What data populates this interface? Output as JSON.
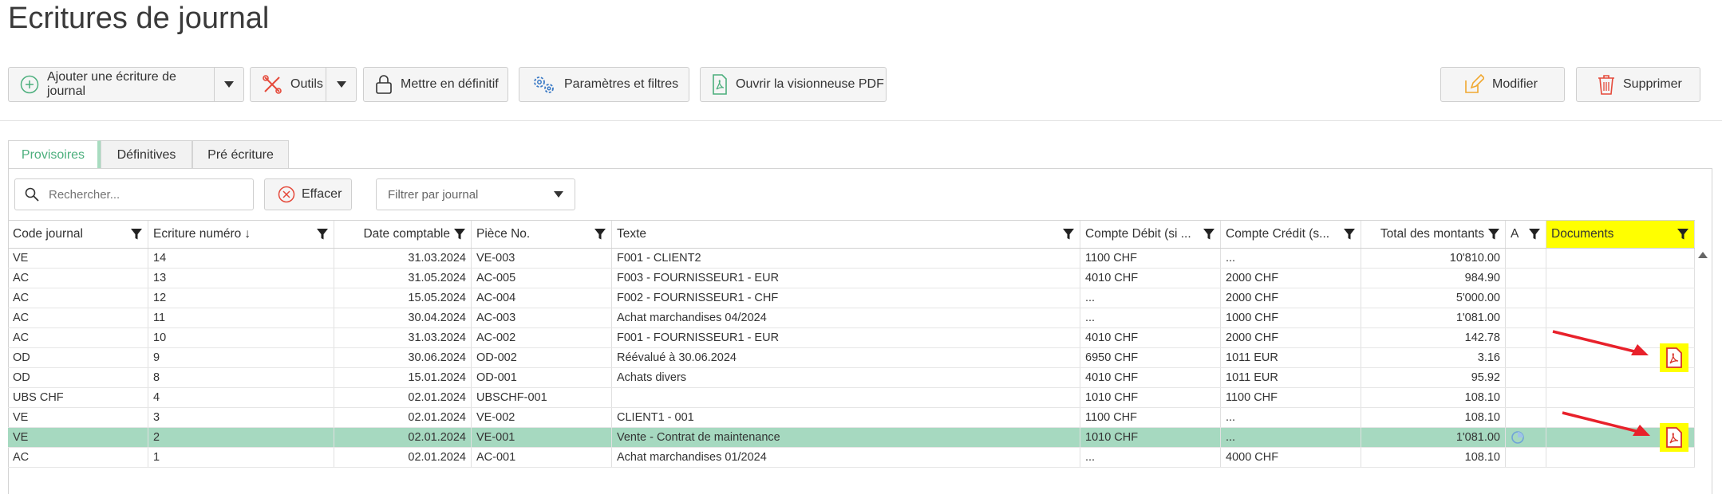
{
  "page": {
    "title": "Ecritures de journal"
  },
  "toolbar": {
    "add_label": "Ajouter une écriture de journal",
    "tools_label": "Outils",
    "finalize_label": "Mettre en définitif",
    "params_label": "Paramètres et filtres",
    "pdf_viewer_label": "Ouvrir la visionneuse PDF",
    "edit_label": "Modifier",
    "delete_label": "Supprimer"
  },
  "tabs": [
    {
      "label": "Provisoires",
      "active": true
    },
    {
      "label": "Définitives",
      "active": false
    },
    {
      "label": "Pré écriture",
      "active": false
    }
  ],
  "filters": {
    "search_placeholder": "Rechercher...",
    "clear_label": "Effacer",
    "journal_placeholder": "Filtrer par journal"
  },
  "table": {
    "columns": [
      "Code journal",
      "Ecriture numéro",
      "Date comptable",
      "Pièce No.",
      "Texte",
      "Compte Débit (si ...",
      "Compte Crédit (s...",
      "Total des montants",
      "A",
      "Documents"
    ],
    "sort_indicator": "↓",
    "rows": [
      {
        "journal": "VE",
        "num": "14",
        "date": "31.03.2024",
        "piece": "VE-003",
        "text": "F001 - CLIENT2",
        "debit": "1100 CHF",
        "credit": "...",
        "total": "10'810.00",
        "attach": false,
        "pdf": false
      },
      {
        "journal": "AC",
        "num": "13",
        "date": "31.05.2024",
        "piece": "AC-005",
        "text": "F003 - FOURNISSEUR1 - EUR",
        "debit": "4010 CHF",
        "credit": "2000 CHF",
        "total": "984.90",
        "attach": false,
        "pdf": false
      },
      {
        "journal": "AC",
        "num": "12",
        "date": "15.05.2024",
        "piece": "AC-004",
        "text": "F002 - FOURNISSEUR1 - CHF",
        "debit": "...",
        "credit": "2000 CHF",
        "total": "5'000.00",
        "attach": false,
        "pdf": false
      },
      {
        "journal": "AC",
        "num": "11",
        "date": "30.04.2024",
        "piece": "AC-003",
        "text": "Achat marchandises 04/2024",
        "debit": "...",
        "credit": "1000 CHF",
        "total": "1'081.00",
        "attach": false,
        "pdf": false
      },
      {
        "journal": "AC",
        "num": "10",
        "date": "31.03.2024",
        "piece": "AC-002",
        "text": "F001 - FOURNISSEUR1 - EUR",
        "debit": "4010 CHF",
        "credit": "2000 CHF",
        "total": "142.78",
        "attach": false,
        "pdf": false
      },
      {
        "journal": "OD",
        "num": "9",
        "date": "30.06.2024",
        "piece": "OD-002",
        "text": "Réévalué à 30.06.2024",
        "debit": "6950 CHF",
        "credit": "1011 EUR",
        "total": "3.16",
        "attach": false,
        "pdf": true
      },
      {
        "journal": "OD",
        "num": "8",
        "date": "15.01.2024",
        "piece": "OD-001",
        "text": "Achats divers",
        "debit": "4010 CHF",
        "credit": "1011 EUR",
        "total": "95.92",
        "attach": false,
        "pdf": false
      },
      {
        "journal": "UBS CHF",
        "num": "4",
        "date": "02.01.2024",
        "piece": "UBSCHF-001",
        "text": "",
        "debit": "1010 CHF",
        "credit": "1100 CHF",
        "total": "108.10",
        "attach": false,
        "pdf": false
      },
      {
        "journal": "VE",
        "num": "3",
        "date": "02.01.2024",
        "piece": "VE-002",
        "text": "CLIENT1 - 001",
        "debit": "1100 CHF",
        "credit": "...",
        "total": "108.10",
        "attach": false,
        "pdf": false
      },
      {
        "journal": "VE",
        "num": "2",
        "date": "02.01.2024",
        "piece": "VE-001",
        "text": "Vente - Contrat de maintenance",
        "debit": "1010 CHF",
        "credit": "...",
        "total": "1'081.00",
        "attach": true,
        "pdf": true,
        "selected": true
      },
      {
        "journal": "AC",
        "num": "1",
        "date": "02.01.2024",
        "piece": "AC-001",
        "text": "Achat marchandises 01/2024",
        "debit": "...",
        "credit": "4000 CHF",
        "total": "108.10",
        "attach": false,
        "pdf": false
      }
    ]
  },
  "colors": {
    "accent": "#4caf7d",
    "selected_row": "#a6d9c0",
    "highlight": "#ffff00",
    "arrow": "#e8212b",
    "pdf_red": "#d9322b"
  },
  "icons": [
    "plus-circle-icon",
    "tools-icon",
    "lock-icon",
    "gears-icon",
    "pdf-file-icon",
    "pencil-icon",
    "trash-icon",
    "search-icon",
    "clear-x-icon",
    "chevron-down-icon",
    "filter-funnel-icon",
    "attachment-icon",
    "pdf-icon"
  ]
}
